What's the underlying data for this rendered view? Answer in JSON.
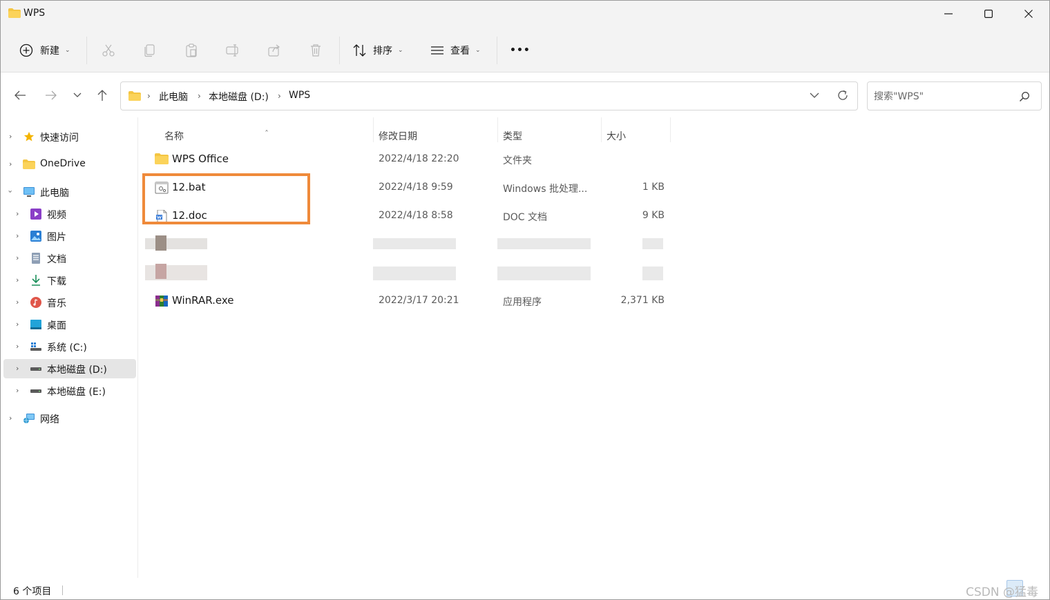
{
  "window": {
    "title": "WPS"
  },
  "toolbar": {
    "new_label": "新建",
    "sort_label": "排序",
    "view_label": "查看",
    "more_label": "•••"
  },
  "address": {
    "crumbs": [
      "此电脑",
      "本地磁盘 (D:)",
      "WPS"
    ]
  },
  "search": {
    "placeholder": "搜索\"WPS\""
  },
  "sidebar": {
    "items": [
      {
        "label": "快速访问",
        "icon": "star-icon"
      },
      {
        "label": "OneDrive",
        "icon": "folder-icon"
      },
      {
        "label": "此电脑",
        "icon": "pc-icon"
      },
      {
        "label": "视频",
        "icon": "video-icon"
      },
      {
        "label": "图片",
        "icon": "pictures-icon"
      },
      {
        "label": "文档",
        "icon": "documents-icon"
      },
      {
        "label": "下载",
        "icon": "download-icon"
      },
      {
        "label": "音乐",
        "icon": "music-icon"
      },
      {
        "label": "桌面",
        "icon": "desktop-icon"
      },
      {
        "label": "系统 (C:)",
        "icon": "drive-c-icon"
      },
      {
        "label": "本地磁盘 (D:)",
        "icon": "drive-icon"
      },
      {
        "label": "本地磁盘 (E:)",
        "icon": "drive-icon"
      },
      {
        "label": "网络",
        "icon": "network-icon"
      }
    ]
  },
  "columns": {
    "name": "名称",
    "modified": "修改日期",
    "type": "类型",
    "size": "大小"
  },
  "files": [
    {
      "name": "WPS Office",
      "modified": "2022/4/18 22:20",
      "type": "文件夹",
      "size": "",
      "icon": "folder-icon"
    },
    {
      "name": "12.bat",
      "modified": "2022/4/18 9:59",
      "type": "Windows 批处理...",
      "size": "1 KB",
      "icon": "batch-file-icon"
    },
    {
      "name": "12.doc",
      "modified": "2022/4/18 8:58",
      "type": "DOC 文档",
      "size": "9 KB",
      "icon": "doc-file-icon"
    },
    {
      "name": "WinRAR.exe",
      "modified": "2022/3/17 20:21",
      "type": "应用程序",
      "size": "2,371 KB",
      "icon": "winrar-icon"
    }
  ],
  "status": {
    "count": "6 个项目",
    "watermark": "CSDN @猛毒"
  },
  "colors": {
    "highlight": "#ef8a3a",
    "selection": "#e5e5e5",
    "folder": "#f4c542"
  }
}
